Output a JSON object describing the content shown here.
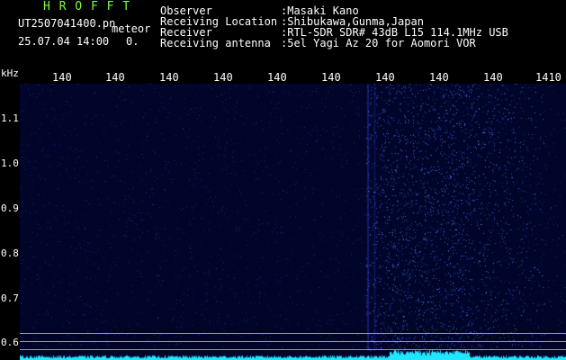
{
  "header": {
    "app_name": "H R O F F T",
    "filename": "UT2507041400.pn",
    "mode_label": "meteor",
    "datetime": "25.07.04 14:00",
    "count": "0.",
    "observer_label": "Observer",
    "observer_value": ":Masaki Kano",
    "location_label": "Receiving Location",
    "location_value": ":Shibukawa,Gunma,Japan",
    "receiver_label": "Receiver",
    "receiver_value": ":RTL-SDR SDR# 43dB L15 114.1MHz USB",
    "antenna_label": "Receiving antenna",
    "antenna_value": ":5el Yagi Az 20 for Aomori VOR"
  },
  "y_axis": {
    "unit": "kHz",
    "ticks": [
      "1.1",
      "1.0",
      "0.9",
      "0.8",
      "0.7",
      "0.6"
    ]
  },
  "x_axis": {
    "ticks": [
      "140",
      "140",
      "140",
      "140",
      "140",
      "140",
      "140",
      "140",
      "140",
      "1410"
    ]
  },
  "colors": {
    "background": "#000000",
    "plot": "#02052a",
    "noise": "#1c2fd0",
    "signal": "#3c5cff",
    "spectrum": "#22e6ff",
    "header_green": "#7CFC4A"
  }
}
